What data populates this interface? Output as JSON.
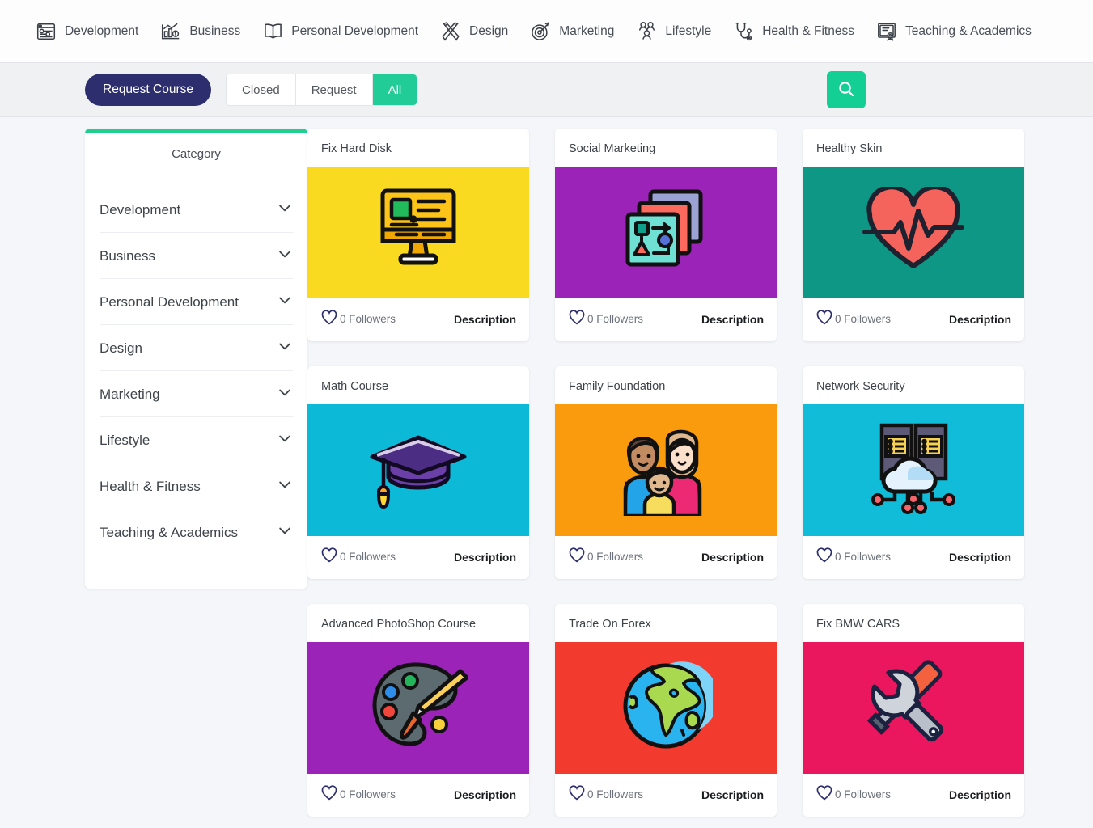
{
  "topnav": {
    "items": [
      {
        "label": "Development",
        "icon": "code-window-icon"
      },
      {
        "label": "Business",
        "icon": "bar-chart-icon"
      },
      {
        "label": "Personal Development",
        "icon": "open-book-icon"
      },
      {
        "label": "Design",
        "icon": "pencil-ruler-icon"
      },
      {
        "label": "Marketing",
        "icon": "target-dart-icon"
      },
      {
        "label": "Lifestyle",
        "icon": "people-group-icon"
      },
      {
        "label": "Health & Fitness",
        "icon": "stethoscope-icon"
      },
      {
        "label": "Teaching & Academics",
        "icon": "certificate-icon"
      }
    ]
  },
  "toolbar": {
    "request_course_label": "Request Course",
    "filters": [
      {
        "label": "Closed",
        "active": false
      },
      {
        "label": "Request",
        "active": false
      },
      {
        "label": "All",
        "active": true
      }
    ],
    "search_icon": "search-icon",
    "accent_green": "#13cf93",
    "navy": "#2c2e6e"
  },
  "sidebar": {
    "title": "Category",
    "top_accent": "#20cf90",
    "items": [
      {
        "label": "Development"
      },
      {
        "label": "Business"
      },
      {
        "label": "Personal Development"
      },
      {
        "label": "Design"
      },
      {
        "label": "Marketing"
      },
      {
        "label": "Lifestyle"
      },
      {
        "label": "Health & Fitness"
      },
      {
        "label": "Teaching & Academics"
      }
    ]
  },
  "cards": [
    {
      "title": "Fix Hard Disk",
      "followers": "0 Followers",
      "description": "Description",
      "bg": "#fada21",
      "icon": "monitor-icon"
    },
    {
      "title": "Social Marketing",
      "followers": "0 Followers",
      "description": "Description",
      "bg": "#9c23b8",
      "icon": "layered-diagram-icon"
    },
    {
      "title": "Healthy Skin",
      "followers": "0 Followers",
      "description": "Description",
      "bg": "#0d9784",
      "icon": "heartbeat-icon"
    },
    {
      "title": "Math Course",
      "followers": "0 Followers",
      "description": "Description",
      "bg": "#0cb9d6",
      "icon": "graduation-cap-icon"
    },
    {
      "title": "Family Foundation",
      "followers": "0 Followers",
      "description": "Description",
      "bg": "#f99b0c",
      "icon": "family-icon"
    },
    {
      "title": "Network Security",
      "followers": "0 Followers",
      "description": "Description",
      "bg": "#11bcd8",
      "icon": "cloud-server-icon"
    },
    {
      "title": "Advanced PhotoShop Course",
      "followers": "0 Followers",
      "description": "Description",
      "bg": "#9c23b8",
      "icon": "paint-palette-icon"
    },
    {
      "title": "Trade On Forex",
      "followers": "0 Followers",
      "description": "Description",
      "bg": "#f23a2e",
      "icon": "globe-icon"
    },
    {
      "title": "Fix BMW CARS",
      "followers": "0 Followers",
      "description": "Description",
      "bg": "#ea175e",
      "icon": "tools-icon"
    }
  ]
}
